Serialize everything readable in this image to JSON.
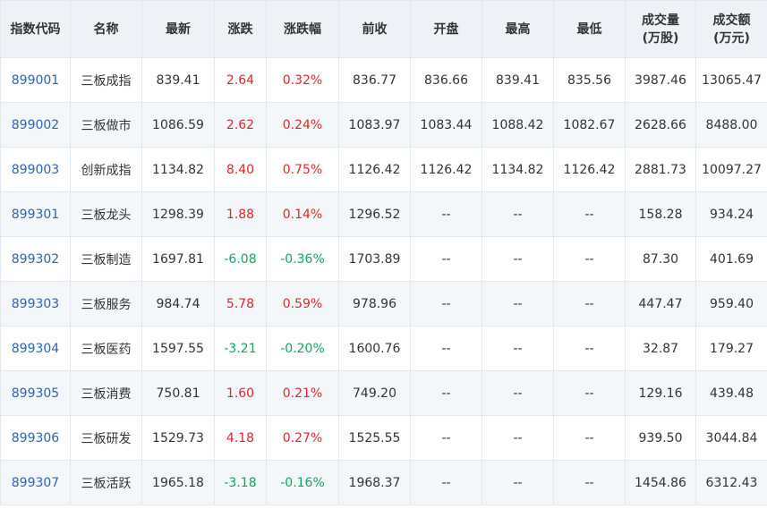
{
  "colors": {
    "up": "#e0262b",
    "down": "#19a15f",
    "code": "#2d64b3",
    "header_bg": "#eef2f6",
    "alt_row_bg": "#f4f7fa"
  },
  "headers": [
    {
      "l1": "指数代码",
      "l2": ""
    },
    {
      "l1": "名称",
      "l2": ""
    },
    {
      "l1": "最新",
      "l2": ""
    },
    {
      "l1": "涨跌",
      "l2": ""
    },
    {
      "l1": "涨跌幅",
      "l2": ""
    },
    {
      "l1": "前收",
      "l2": ""
    },
    {
      "l1": "开盘",
      "l2": ""
    },
    {
      "l1": "最高",
      "l2": ""
    },
    {
      "l1": "最低",
      "l2": ""
    },
    {
      "l1": "成交量",
      "l2": "(万股)"
    },
    {
      "l1": "成交额",
      "l2": "(万元)"
    }
  ],
  "rows": [
    {
      "code": "899001",
      "name": "三板成指",
      "last": "839.41",
      "chg": "2.64",
      "pct": "0.32%",
      "prev": "836.77",
      "open": "836.66",
      "high": "839.41",
      "low": "835.56",
      "vol": "3987.46",
      "amt": "13065.47",
      "dir": "up"
    },
    {
      "code": "899002",
      "name": "三板做市",
      "last": "1086.59",
      "chg": "2.62",
      "pct": "0.24%",
      "prev": "1083.97",
      "open": "1083.44",
      "high": "1088.42",
      "low": "1082.67",
      "vol": "2628.66",
      "amt": "8488.00",
      "dir": "up"
    },
    {
      "code": "899003",
      "name": "创新成指",
      "last": "1134.82",
      "chg": "8.40",
      "pct": "0.75%",
      "prev": "1126.42",
      "open": "1126.42",
      "high": "1134.82",
      "low": "1126.42",
      "vol": "2881.73",
      "amt": "10097.27",
      "dir": "up"
    },
    {
      "code": "899301",
      "name": "三板龙头",
      "last": "1298.39",
      "chg": "1.88",
      "pct": "0.14%",
      "prev": "1296.52",
      "open": "--",
      "high": "--",
      "low": "--",
      "vol": "158.28",
      "amt": "934.24",
      "dir": "up"
    },
    {
      "code": "899302",
      "name": "三板制造",
      "last": "1697.81",
      "chg": "-6.08",
      "pct": "-0.36%",
      "prev": "1703.89",
      "open": "--",
      "high": "--",
      "low": "--",
      "vol": "87.30",
      "amt": "401.69",
      "dir": "down"
    },
    {
      "code": "899303",
      "name": "三板服务",
      "last": "984.74",
      "chg": "5.78",
      "pct": "0.59%",
      "prev": "978.96",
      "open": "--",
      "high": "--",
      "low": "--",
      "vol": "447.47",
      "amt": "959.40",
      "dir": "up"
    },
    {
      "code": "899304",
      "name": "三板医药",
      "last": "1597.55",
      "chg": "-3.21",
      "pct": "-0.20%",
      "prev": "1600.76",
      "open": "--",
      "high": "--",
      "low": "--",
      "vol": "32.87",
      "amt": "179.27",
      "dir": "down"
    },
    {
      "code": "899305",
      "name": "三板消费",
      "last": "750.81",
      "chg": "1.60",
      "pct": "0.21%",
      "prev": "749.20",
      "open": "--",
      "high": "--",
      "low": "--",
      "vol": "129.16",
      "amt": "439.48",
      "dir": "up"
    },
    {
      "code": "899306",
      "name": "三板研发",
      "last": "1529.73",
      "chg": "4.18",
      "pct": "0.27%",
      "prev": "1525.55",
      "open": "--",
      "high": "--",
      "low": "--",
      "vol": "939.50",
      "amt": "3044.84",
      "dir": "up"
    },
    {
      "code": "899307",
      "name": "三板活跃",
      "last": "1965.18",
      "chg": "-3.18",
      "pct": "-0.16%",
      "prev": "1968.37",
      "open": "--",
      "high": "--",
      "low": "--",
      "vol": "1454.86",
      "amt": "6312.43",
      "dir": "down"
    }
  ]
}
